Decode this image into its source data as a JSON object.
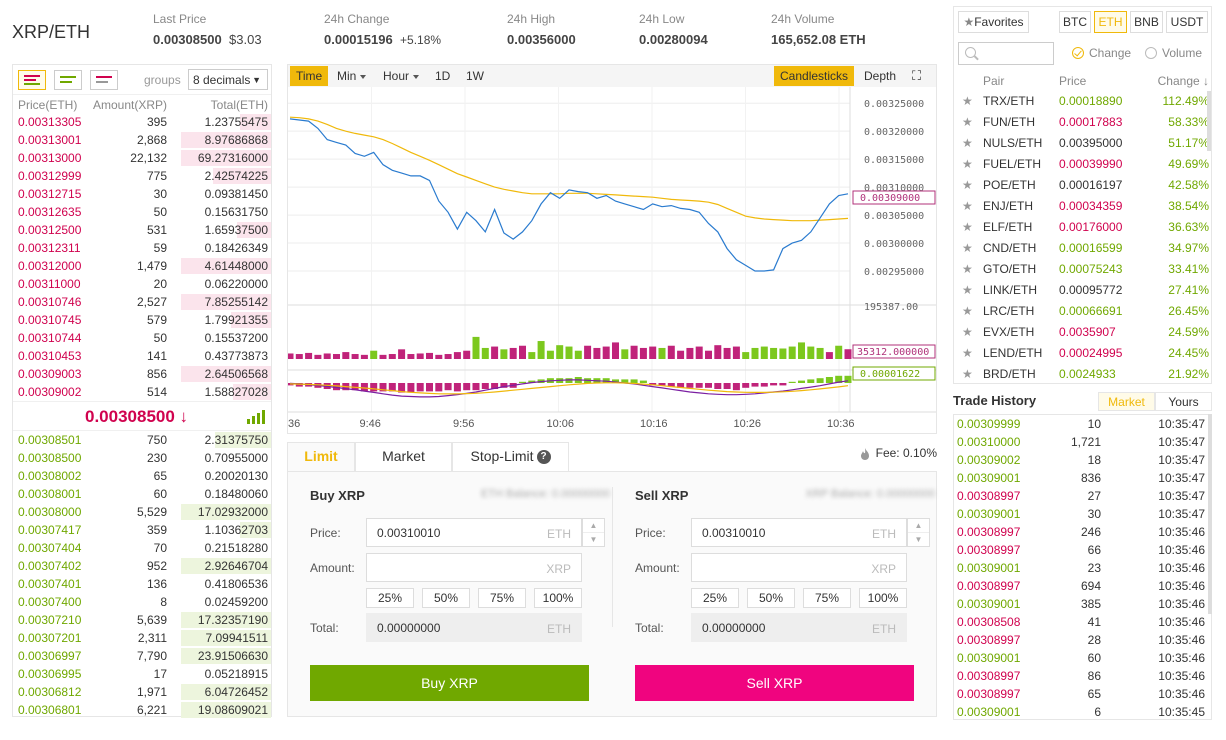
{
  "header": {
    "pair": "XRP/ETH",
    "last_price_label": "Last Price",
    "last_price": "0.00308500",
    "last_price_usd": "$3.03",
    "change_label": "24h Change",
    "change_value": "0.00015196",
    "change_pct": "+5.18%",
    "high_label": "24h High",
    "high_value": "0.00356000",
    "low_label": "24h Low",
    "low_value": "0.00280094",
    "volume_label": "24h Volume",
    "volume_value": "165,652.08 ETH"
  },
  "orderbook": {
    "groups_label": "groups",
    "groups_value": "8 decimals",
    "col_price": "Price(ETH)",
    "col_amount": "Amount(XRP)",
    "col_total": "Total(ETH)",
    "asks": [
      {
        "price": "0.00313305",
        "amount": "395",
        "total": "1.23755475",
        "depth": 0.35
      },
      {
        "price": "0.00313001",
        "amount": "2,868",
        "total": "8.97686868",
        "depth": 1.0
      },
      {
        "price": "0.00313000",
        "amount": "22,132",
        "total": "69.27316000",
        "depth": 1.0
      },
      {
        "price": "0.00312999",
        "amount": "775",
        "total": "2.42574225",
        "depth": 0.65
      },
      {
        "price": "0.00312715",
        "amount": "30",
        "total": "0.09381450",
        "depth": 0.0
      },
      {
        "price": "0.00312635",
        "amount": "50",
        "total": "0.15631750",
        "depth": 0.0
      },
      {
        "price": "0.00312500",
        "amount": "531",
        "total": "1.65937500",
        "depth": 0.38
      },
      {
        "price": "0.00312311",
        "amount": "59",
        "total": "0.18426349",
        "depth": 0.0
      },
      {
        "price": "0.00312000",
        "amount": "1,479",
        "total": "4.61448000",
        "depth": 1.0
      },
      {
        "price": "0.00311000",
        "amount": "20",
        "total": "0.06220000",
        "depth": 0.0
      },
      {
        "price": "0.00310746",
        "amount": "2,527",
        "total": "7.85255142",
        "depth": 1.0
      },
      {
        "price": "0.00310745",
        "amount": "579",
        "total": "1.79921355",
        "depth": 0.45
      },
      {
        "price": "0.00310744",
        "amount": "50",
        "total": "0.15537200",
        "depth": 0.0
      },
      {
        "price": "0.00310453",
        "amount": "141",
        "total": "0.43773873",
        "depth": 0.0
      },
      {
        "price": "0.00309003",
        "amount": "856",
        "total": "2.64506568",
        "depth": 1.0
      },
      {
        "price": "0.00309002",
        "amount": "514",
        "total": "1.58827028",
        "depth": 0.42
      }
    ],
    "last_price": "0.00308500 ↓",
    "bids": [
      {
        "price": "0.00308501",
        "amount": "750",
        "total": "2.31375750",
        "depth": 0.62
      },
      {
        "price": "0.00308500",
        "amount": "230",
        "total": "0.70955000",
        "depth": 0.0
      },
      {
        "price": "0.00308002",
        "amount": "65",
        "total": "0.20020130",
        "depth": 0.0
      },
      {
        "price": "0.00308001",
        "amount": "60",
        "total": "0.18480060",
        "depth": 0.0
      },
      {
        "price": "0.00308000",
        "amount": "5,529",
        "total": "17.02932000",
        "depth": 1.0
      },
      {
        "price": "0.00307417",
        "amount": "359",
        "total": "1.10362703",
        "depth": 0.35
      },
      {
        "price": "0.00307404",
        "amount": "70",
        "total": "0.21518280",
        "depth": 0.0
      },
      {
        "price": "0.00307402",
        "amount": "952",
        "total": "2.92646704",
        "depth": 1.0
      },
      {
        "price": "0.00307401",
        "amount": "136",
        "total": "0.41806536",
        "depth": 0.0
      },
      {
        "price": "0.00307400",
        "amount": "8",
        "total": "0.02459200",
        "depth": 0.0
      },
      {
        "price": "0.00307210",
        "amount": "5,639",
        "total": "17.32357190",
        "depth": 1.0
      },
      {
        "price": "0.00307201",
        "amount": "2,311",
        "total": "7.09941511",
        "depth": 1.0
      },
      {
        "price": "0.00306997",
        "amount": "7,790",
        "total": "23.91506630",
        "depth": 1.0
      },
      {
        "price": "0.00306995",
        "amount": "17",
        "total": "0.05218915",
        "depth": 0.0
      },
      {
        "price": "0.00306812",
        "amount": "1,971",
        "total": "6.04726452",
        "depth": 1.0
      },
      {
        "price": "0.00306801",
        "amount": "6,221",
        "total": "19.08609021",
        "depth": 1.0
      }
    ]
  },
  "chart": {
    "intervals": [
      "Time",
      "Min",
      "Hour",
      "1D",
      "1W"
    ],
    "candlesticks": "Candlesticks",
    "depth": "Depth",
    "price_axis": [
      "0.00325000",
      "0.00320000",
      "0.00315000",
      "0.00310000",
      "0.00305000",
      "0.00300000",
      "0.00295000"
    ],
    "price_tag": "0.00309000",
    "vol_max": "195387.00",
    "vol_tag": "35312.000000",
    "macd_tag": "0.00001622",
    "time_axis": [
      "36",
      "9:46",
      "9:56",
      "10:06",
      "10:16",
      "10:26",
      "10:36"
    ]
  },
  "chart_data": {
    "type": "line",
    "price_ylim": [
      0.0029,
      0.00327
    ],
    "price": [
      0.003222,
      0.00322,
      0.003218,
      0.003205,
      0.003185,
      0.00318,
      0.003175,
      0.00316,
      0.003155,
      0.003162,
      0.00314,
      0.00313,
      0.003125,
      0.00312,
      0.00312,
      0.003112,
      0.003075,
      0.003055,
      0.003025,
      0.003055,
      0.00304,
      0.00302,
      0.00306,
      0.003018,
      0.003007,
      0.00302,
      0.00304,
      0.00307,
      0.00309,
      0.00308,
      0.003095,
      0.003092,
      0.00309,
      0.00308,
      0.003085,
      0.003075,
      0.00307,
      0.003065,
      0.00306,
      0.00307,
      0.003065,
      0.003067,
      0.003062,
      0.00306,
      0.003055,
      0.003035,
      0.00302,
      0.00299,
      0.00297,
      0.00296,
      0.00295,
      0.00295,
      0.002952,
      0.00299,
      0.003,
      0.003005,
      0.00302,
      0.003045,
      0.00307,
      0.003085,
      0.003088
    ],
    "ma": [
      0.003225,
      0.003224,
      0.003222,
      0.003218,
      0.003212,
      0.003205,
      0.0032,
      0.003196,
      0.003193,
      0.00319,
      0.003185,
      0.003178,
      0.00317,
      0.003162,
      0.003155,
      0.003148,
      0.00314,
      0.003132,
      0.003124,
      0.003118,
      0.003112,
      0.003106,
      0.0031,
      0.003096,
      0.003093,
      0.00309,
      0.003088,
      0.003088,
      0.003088,
      0.003088,
      0.003089,
      0.003089,
      0.003089,
      0.003088,
      0.003087,
      0.003086,
      0.003085,
      0.003084,
      0.003083,
      0.003082,
      0.00308,
      0.003078,
      0.003077,
      0.003076,
      0.003075,
      0.003073,
      0.003069,
      0.003062,
      0.003055,
      0.003048,
      0.003045,
      0.003043,
      0.003042,
      0.003041,
      0.00304,
      0.00304,
      0.00304,
      0.003041,
      0.003042,
      0.003043,
      0.003044
    ],
    "volume_max": 195387,
    "volume": [
      {
        "v": 20000,
        "up": false
      },
      {
        "v": 18000,
        "up": false
      },
      {
        "v": 22000,
        "up": false
      },
      {
        "v": 15000,
        "up": false
      },
      {
        "v": 20000,
        "up": false
      },
      {
        "v": 18000,
        "up": false
      },
      {
        "v": 25000,
        "up": false
      },
      {
        "v": 18000,
        "up": false
      },
      {
        "v": 15000,
        "up": false
      },
      {
        "v": 30000,
        "up": true
      },
      {
        "v": 15000,
        "up": false
      },
      {
        "v": 18000,
        "up": false
      },
      {
        "v": 35000,
        "up": false
      },
      {
        "v": 18000,
        "up": false
      },
      {
        "v": 20000,
        "up": false
      },
      {
        "v": 22000,
        "up": false
      },
      {
        "v": 15000,
        "up": false
      },
      {
        "v": 18000,
        "up": false
      },
      {
        "v": 25000,
        "up": false
      },
      {
        "v": 30000,
        "up": false
      },
      {
        "v": 80000,
        "up": true
      },
      {
        "v": 40000,
        "up": true
      },
      {
        "v": 45000,
        "up": false
      },
      {
        "v": 35000,
        "up": true
      },
      {
        "v": 40000,
        "up": false
      },
      {
        "v": 48000,
        "up": false
      },
      {
        "v": 25000,
        "up": true
      },
      {
        "v": 65000,
        "up": true
      },
      {
        "v": 30000,
        "up": true
      },
      {
        "v": 50000,
        "up": true
      },
      {
        "v": 45000,
        "up": true
      },
      {
        "v": 30000,
        "up": true
      },
      {
        "v": 48000,
        "up": false
      },
      {
        "v": 40000,
        "up": false
      },
      {
        "v": 45000,
        "up": false
      },
      {
        "v": 60000,
        "up": false
      },
      {
        "v": 35000,
        "up": true
      },
      {
        "v": 48000,
        "up": false
      },
      {
        "v": 40000,
        "up": false
      },
      {
        "v": 45000,
        "up": false
      },
      {
        "v": 40000,
        "up": true
      },
      {
        "v": 48000,
        "up": false
      },
      {
        "v": 30000,
        "up": false
      },
      {
        "v": 40000,
        "up": false
      },
      {
        "v": 45000,
        "up": false
      },
      {
        "v": 30000,
        "up": false
      },
      {
        "v": 50000,
        "up": false
      },
      {
        "v": 40000,
        "up": false
      },
      {
        "v": 45000,
        "up": false
      },
      {
        "v": 25000,
        "up": true
      },
      {
        "v": 40000,
        "up": true
      },
      {
        "v": 45000,
        "up": true
      },
      {
        "v": 40000,
        "up": true
      },
      {
        "v": 38000,
        "up": true
      },
      {
        "v": 45000,
        "up": true
      },
      {
        "v": 60000,
        "up": true
      },
      {
        "v": 45000,
        "up": true
      },
      {
        "v": 40000,
        "up": true
      },
      {
        "v": 25000,
        "up": false
      },
      {
        "v": 48000,
        "up": true
      },
      {
        "v": 35312,
        "up": false
      }
    ],
    "macd_hist": [
      -2,
      -3,
      -3,
      -4,
      -5,
      -6,
      -6,
      -6,
      -7,
      -7,
      -7,
      -7,
      -8,
      -8,
      -7,
      -7,
      -7,
      -6,
      -7,
      -6,
      -6,
      -5,
      -5,
      -4,
      -4,
      1,
      2,
      3,
      4,
      4,
      4,
      5,
      4,
      4,
      4,
      3,
      3,
      3,
      2,
      -2,
      -2,
      -3,
      -4,
      -4,
      -4,
      -4,
      -5,
      -5,
      -6,
      -4,
      -3,
      -3,
      -2,
      -2,
      1,
      2,
      3,
      4,
      5,
      6,
      6
    ],
    "macd_line": [
      -0.5,
      -1,
      -1.8,
      -2.8,
      -3.8,
      -5,
      -6.2,
      -7.5,
      -9,
      -10.5,
      -12,
      -13.5,
      -14.5,
      -15,
      -15.5,
      -15.5,
      -15,
      -14,
      -13,
      -11.5,
      -10,
      -8,
      -6,
      -4,
      -2.5,
      -1,
      0.5,
      1.5,
      2.5,
      3,
      3.5,
      3.5,
      3,
      2.5,
      2,
      1,
      0,
      -1,
      -2.5,
      -4,
      -5.5,
      -7,
      -8.5,
      -10,
      -11,
      -12,
      -12.5,
      -13,
      -13,
      -12.5,
      -12,
      -11,
      -10,
      -9,
      -7.5,
      -6,
      -4.5,
      -3,
      -1,
      1,
      2.5
    ],
    "signal_line": [
      -1,
      -1.2,
      -1.5,
      -2,
      -2.6,
      -3.2,
      -4,
      -4.8,
      -5.6,
      -6.5,
      -7.5,
      -8.5,
      -9.5,
      -10.3,
      -11,
      -11.6,
      -12,
      -12.1,
      -12,
      -11.8,
      -11.4,
      -10.8,
      -10,
      -9,
      -8,
      -7,
      -6,
      -5,
      -4,
      -3,
      -2,
      -1.2,
      -0.5,
      0,
      0.2,
      0.2,
      0,
      -0.5,
      -1.2,
      -2,
      -3,
      -4,
      -5,
      -6,
      -7,
      -8,
      -8.8,
      -9.5,
      -10,
      -10.3,
      -10.5,
      -10.4,
      -10.2,
      -9.8,
      -9.2,
      -8.5,
      -7.6,
      -6.6,
      -5.5,
      -4.3,
      -3
    ]
  },
  "trade": {
    "tabs": [
      "Limit",
      "Market",
      "Stop-Limit"
    ],
    "fee": "Fee: 0.10%",
    "buy": {
      "title": "Buy XRP",
      "balance": "ETH Balance: 0.00000000",
      "price_label": "Price:",
      "price_value": "0.00310010",
      "price_unit": "ETH",
      "amount_label": "Amount:",
      "amount_unit": "XRP",
      "total_label": "Total:",
      "total_value": "0.00000000",
      "total_unit": "ETH",
      "button": "Buy XRP"
    },
    "sell": {
      "title": "Sell XRP",
      "balance": "XRP Balance: 0.00000000",
      "price_label": "Price:",
      "price_value": "0.00310010",
      "price_unit": "ETH",
      "amount_label": "Amount:",
      "amount_unit": "XRP",
      "total_label": "Total:",
      "total_value": "0.00000000",
      "total_unit": "ETH",
      "button": "Sell XRP"
    },
    "percents": [
      "25%",
      "50%",
      "75%",
      "100%"
    ],
    "colors": {
      "buy": "#70a800",
      "sell": "#f0047f"
    }
  },
  "markets": {
    "favorites": "Favorites",
    "quotes": [
      "BTC",
      "ETH",
      "BNB",
      "USDT"
    ],
    "radio_change": "Change",
    "radio_volume": "Volume",
    "col_pair": "Pair",
    "col_price": "Price",
    "col_change": "Change ↓",
    "rows": [
      {
        "pair": "TRX/ETH",
        "price": "0.00018890",
        "change": "112.49%",
        "dir": "up"
      },
      {
        "pair": "FUN/ETH",
        "price": "0.00017883",
        "change": "58.33%",
        "dir": "down"
      },
      {
        "pair": "NULS/ETH",
        "price": "0.00395000",
        "change": "51.17%",
        "dir": "flat"
      },
      {
        "pair": "FUEL/ETH",
        "price": "0.00039990",
        "change": "49.69%",
        "dir": "down"
      },
      {
        "pair": "POE/ETH",
        "price": "0.00016197",
        "change": "42.58%",
        "dir": "flat"
      },
      {
        "pair": "ENJ/ETH",
        "price": "0.00034359",
        "change": "38.54%",
        "dir": "down"
      },
      {
        "pair": "ELF/ETH",
        "price": "0.00176000",
        "change": "36.63%",
        "dir": "down"
      },
      {
        "pair": "CND/ETH",
        "price": "0.00016599",
        "change": "34.97%",
        "dir": "up"
      },
      {
        "pair": "GTO/ETH",
        "price": "0.00075243",
        "change": "33.41%",
        "dir": "up"
      },
      {
        "pair": "LINK/ETH",
        "price": "0.00095772",
        "change": "27.41%",
        "dir": "flat"
      },
      {
        "pair": "LRC/ETH",
        "price": "0.00066691",
        "change": "26.45%",
        "dir": "up"
      },
      {
        "pair": "EVX/ETH",
        "price": "0.0035907",
        "change": "24.59%",
        "dir": "down"
      },
      {
        "pair": "LEND/ETH",
        "price": "0.00024995",
        "change": "24.45%",
        "dir": "down"
      },
      {
        "pair": "BRD/ETH",
        "price": "0.0024933",
        "change": "21.92%",
        "dir": "up"
      }
    ]
  },
  "history": {
    "title": "Trade History",
    "tab_market": "Market",
    "tab_yours": "Yours",
    "rows": [
      {
        "price": "0.00309999",
        "amount": "10",
        "time": "10:35:47",
        "side": "buy"
      },
      {
        "price": "0.00310000",
        "amount": "1,721",
        "time": "10:35:47",
        "side": "buy"
      },
      {
        "price": "0.00309002",
        "amount": "18",
        "time": "10:35:47",
        "side": "buy"
      },
      {
        "price": "0.00309001",
        "amount": "836",
        "time": "10:35:47",
        "side": "buy"
      },
      {
        "price": "0.00308997",
        "amount": "27",
        "time": "10:35:47",
        "side": "sell"
      },
      {
        "price": "0.00309001",
        "amount": "30",
        "time": "10:35:47",
        "side": "buy"
      },
      {
        "price": "0.00308997",
        "amount": "246",
        "time": "10:35:46",
        "side": "sell"
      },
      {
        "price": "0.00308997",
        "amount": "66",
        "time": "10:35:46",
        "side": "sell"
      },
      {
        "price": "0.00309001",
        "amount": "23",
        "time": "10:35:46",
        "side": "buy"
      },
      {
        "price": "0.00308997",
        "amount": "694",
        "time": "10:35:46",
        "side": "sell"
      },
      {
        "price": "0.00309001",
        "amount": "385",
        "time": "10:35:46",
        "side": "buy"
      },
      {
        "price": "0.00308508",
        "amount": "41",
        "time": "10:35:46",
        "side": "sell"
      },
      {
        "price": "0.00308997",
        "amount": "28",
        "time": "10:35:46",
        "side": "sell"
      },
      {
        "price": "0.00309001",
        "amount": "60",
        "time": "10:35:46",
        "side": "buy"
      },
      {
        "price": "0.00308997",
        "amount": "86",
        "time": "10:35:46",
        "side": "sell"
      },
      {
        "price": "0.00308997",
        "amount": "65",
        "time": "10:35:46",
        "side": "sell"
      },
      {
        "price": "0.00309001",
        "amount": "6",
        "time": "10:35:45",
        "side": "buy"
      }
    ]
  }
}
